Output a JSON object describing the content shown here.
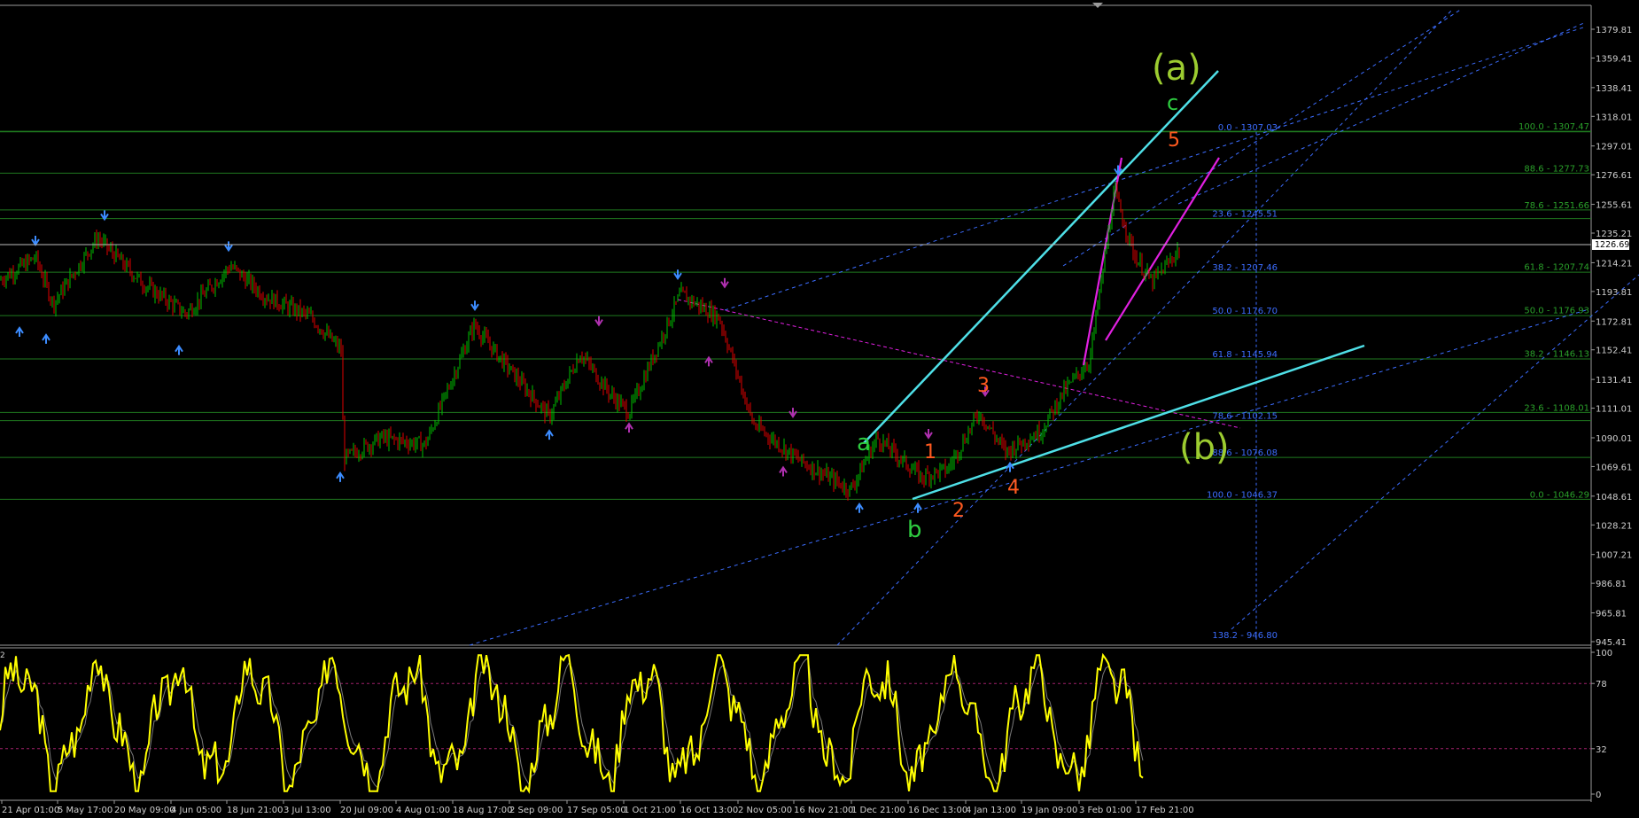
{
  "chart_data": {
    "type": "line",
    "price_axis": {
      "ticks": [
        "1379.81",
        "1359.41",
        "1338.41",
        "1318.01",
        "1297.01",
        "1276.61",
        "1255.61",
        "1235.21",
        "1214.21",
        "1193.81",
        "1172.81",
        "1152.41",
        "1131.41",
        "1111.01",
        "1090.01",
        "1069.61",
        "1048.61",
        "1028.21",
        "1007.21",
        "986.81",
        "965.81",
        "945.41"
      ],
      "range": [
        945.41,
        1379.81
      ],
      "current_price_label": "1226.69",
      "current_price": 1226.69
    },
    "time_axis": {
      "labels": [
        "21 Apr 01:00",
        "5 May 17:00",
        "20 May 09:00",
        "4 Jun 05:00",
        "18 Jun 21:00",
        "3 Jul 13:00",
        "20 Jul 09:00",
        "4 Aug 01:00",
        "18 Aug 17:00",
        "2 Sep 09:00",
        "17 Sep 05:00",
        "1 Oct 21:00",
        "16 Oct 13:00",
        "2 Nov 05:00",
        "16 Nov 21:00",
        "1 Dec 21:00",
        "16 Dec 13:00",
        "4 Jan 13:00",
        "19 Jan 09:00",
        "3 Feb 01:00",
        "17 Feb 21:00"
      ]
    },
    "oscillator_axis": {
      "ticks": [
        "100",
        "78",
        "32",
        "0"
      ],
      "indicator_label": "2",
      "overbought": 78,
      "oversold": 32
    },
    "fib_levels_left": [
      {
        "label": "0.0 - 1307.03",
        "price": 1307.03
      },
      {
        "label": "23.6 - 1245.51",
        "price": 1245.51
      },
      {
        "label": "38.2 - 1207.46",
        "price": 1207.46
      },
      {
        "label": "50.0 - 1176.70",
        "price": 1176.7
      },
      {
        "label": "61.8 - 1145.94",
        "price": 1145.94
      },
      {
        "label": "78.6 - 1102.15",
        "price": 1102.15
      },
      {
        "label": "88.6 - 1076.08",
        "price": 1076.08
      },
      {
        "label": "100.0 - 1046.37",
        "price": 1046.37
      },
      {
        "label": "138.2 - 946.80",
        "price": 946.8
      }
    ],
    "fib_levels_right": [
      {
        "label": "100.0 - 1307.47",
        "price": 1307.47
      },
      {
        "label": "88.6 - 1277.73",
        "price": 1277.73
      },
      {
        "label": "78.6 - 1251.66",
        "price": 1251.66
      },
      {
        "label": "61.8 - 1207.74",
        "price": 1207.74
      },
      {
        "label": "50.0 - 1176.93",
        "price": 1176.93
      },
      {
        "label": "38.2 - 1146.13",
        "price": 1146.13
      },
      {
        "label": "23.6 - 1108.01",
        "price": 1108.01
      },
      {
        "label": "0.0 - 1046.29",
        "price": 1046.29
      }
    ],
    "wave_labels": {
      "big_a": "(a)",
      "big_b": "(b)",
      "a": "a",
      "b": "b",
      "c": "c",
      "w1": "1",
      "w2": "2",
      "w3": "3",
      "w4": "4",
      "w5": "5"
    },
    "colors": {
      "background": "#000000",
      "bull_candle": "#00c000",
      "bear_candle": "#e00000",
      "grid_green": "#1f7a1f",
      "fib_blue": "#3c6dff",
      "channel_cyan": "#4fe0e8",
      "channel_magenta": "#e020e0",
      "oscillator_main": "#ffff00",
      "oscillator_signal": "#7a7a7a",
      "wave_green": "#2ecc40",
      "wave_orange": "#ff5a1f",
      "wave_olive": "#9ccc30"
    }
  }
}
